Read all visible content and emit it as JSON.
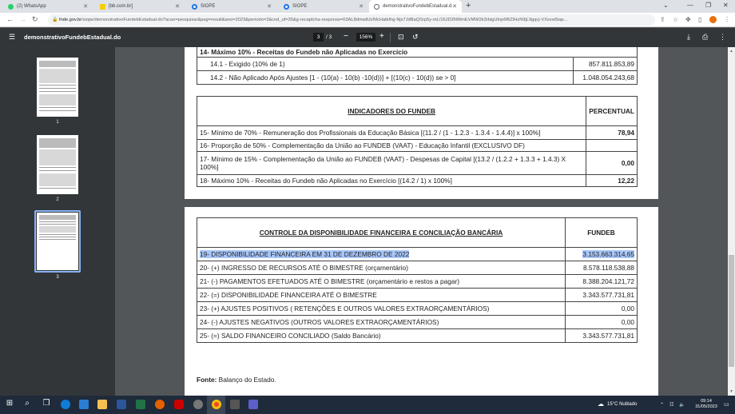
{
  "browser": {
    "tabs": [
      {
        "label": "(2) WhatsApp",
        "color": "#25d366"
      },
      {
        "label": "[bb.com.br]",
        "color": "#f5d000"
      },
      {
        "label": "SIOPE",
        "color": "#1a73e8"
      },
      {
        "label": "SIOPE",
        "color": "#1a73e8"
      },
      {
        "label": "demonstrativoFundebEstadual.d...",
        "color": "#e8eaed"
      }
    ],
    "new_tab": "+",
    "url_host": "fnde.gov.br",
    "url_rest": "/siope/demonstrativoFundebEstadual.do?acao=pesquisar&pag=result&ano=2023&periodo=2&cod_uf=35&g-recaptcha-response=03AL8dmw8JzNlcHatkIhg-Njx7JdBaQSrp5y-mL/16JD2NWmEVMW2k3rbigUInp6f6ZIHzN9jL9gqcj-VXsvw5iap..."
  },
  "pdf": {
    "title": "demonstrativoFundebEstadual.do",
    "current_page": "3",
    "total_pages": "/ 3",
    "zoom": "156%",
    "thumbnails": [
      "1",
      "2",
      "3"
    ]
  },
  "table1": {
    "header": "14- Máximo 10% - Receitas do Fundeb não Aplicadas no Exercício",
    "rows": [
      {
        "label": "14.1 - Exigido (10% de 1)",
        "value": "857.811.853,89"
      },
      {
        "label": "14.2 - Não Aplicado Após Ajustes [1 - (10(a) - 10(b) -10(d))] + [(10(c) - 10(d)) se > 0]",
        "value": "1.048.054.243,68"
      }
    ]
  },
  "table2": {
    "col1": "INDICADORES DO FUNDEB",
    "col2": "PERCENTUAL",
    "rows": [
      {
        "label": "15- Mínimo de 70% - Remuneração dos Profissionais da Educação Básica [(11.2 / (1 - 1.2.3 - 1.3.4 - 1.4.4)] x 100%]",
        "value": "78,94"
      },
      {
        "label": "16- Proporção de 50% - Complementação da União ao FUNDEB (VAAT) - Educação Infantil (EXCLUSIVO DF)",
        "value": ""
      },
      {
        "label": "17- Mínimo de 15% - Complementação da União ao FUNDEB (VAAT) - Despesas de Capital [(13.2 / (1.2.2 + 1.3.3 + 1.4.3) X 100%]",
        "value": "0,00"
      },
      {
        "label": "18- Máximo 10% - Receitas do Fundeb não Aplicadas no Exercício [(14.2 / 1) x 100%]",
        "value": "12,22"
      }
    ]
  },
  "table3": {
    "col1": "CONTROLE DA DISPONIBILIDADE FINANCEIRA E CONCILIAÇÃO BANCÁRIA",
    "col2": "FUNDEB",
    "rows": [
      {
        "label": "19- DISPONIBILIDADE FINANCEIRA EM 31 DE DEZEMBRO DE 2022",
        "value": "3.153.663.314,65"
      },
      {
        "label": "20- (+) INGRESSO DE RECURSOS ATÉ O BIMESTRE (orçamentário)",
        "value": "8.578.118.538,88"
      },
      {
        "label": "21- (-) PAGAMENTOS EFETUADOS ATÉ O BIMESTRE (orçamentário e restos a pagar)",
        "value": "8.388.204.121,72"
      },
      {
        "label": "22- (=) DISPONIBILIDADE FINANCEIRA ATÉ O BIMESTRE",
        "value": "3.343.577.731,81"
      },
      {
        "label": "23- (+) AJUSTES POSITIVOS ( RETENÇÕES E OUTROS VALORES EXTRAORÇAMENTÁRIOS)",
        "value": "0,00"
      },
      {
        "label": "24- (-) AJUSTES NEGATIVOS (OUTROS VALORES EXTRAORÇAMENTÁRIOS)",
        "value": "0,00"
      },
      {
        "label": "25- (=) SALDO FINANCEIRO CONCILIADO (Saldo Bancário)",
        "value": "3.343.577.731,81"
      }
    ]
  },
  "footer": {
    "label": "Fonte:",
    "text": "Balanço do Estado."
  },
  "taskbar": {
    "weather": "15°C  Nublado",
    "time": "09:14",
    "date": "31/05/2023"
  }
}
